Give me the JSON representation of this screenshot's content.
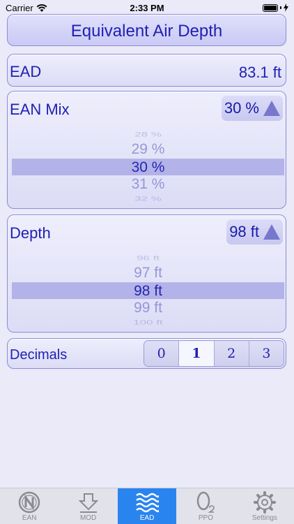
{
  "status_bar": {
    "carrier": "Carrier",
    "time": "2:33 PM"
  },
  "header": {
    "title": "Equivalent Air Depth"
  },
  "ead": {
    "label": "EAD",
    "value": "83.1 ft"
  },
  "ean_mix": {
    "label": "EAN Mix",
    "selected": "30 %",
    "wheel": [
      "28 %",
      "29 %",
      "30 %",
      "31 %",
      "32 %"
    ]
  },
  "depth": {
    "label": "Depth",
    "selected": "98 ft",
    "wheel": [
      "96 ft",
      "97 ft",
      "98 ft",
      "99 ft",
      "100 ft"
    ]
  },
  "decimals": {
    "label": "Decimals",
    "options": [
      "0",
      "1",
      "2",
      "3"
    ],
    "selected_index": 1
  },
  "tabs": [
    {
      "label": "EAN",
      "icon": "ean-icon"
    },
    {
      "label": "MOD",
      "icon": "mod-icon"
    },
    {
      "label": "EAD",
      "icon": "ead-waves-icon",
      "active": true
    },
    {
      "label": "PPO",
      "icon": "ppo-icon"
    },
    {
      "label": "Settings",
      "icon": "gear-icon"
    }
  ],
  "colors": {
    "accent": "#2a84f0",
    "text": "#2020b4",
    "panel_border": "#8c8cd6"
  }
}
